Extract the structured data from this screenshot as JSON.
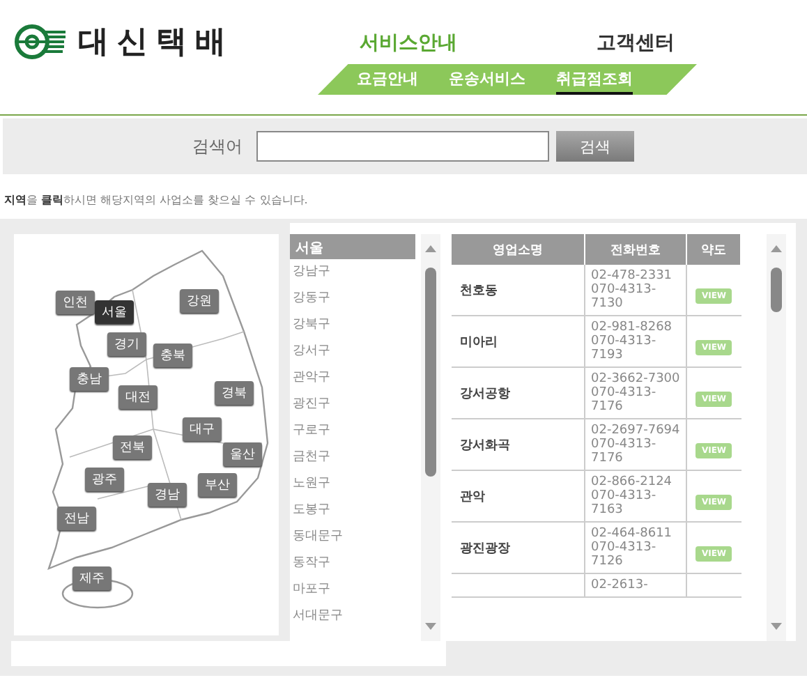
{
  "logo": {
    "name": "대신택배"
  },
  "nav": {
    "sections": [
      {
        "label": "서비스안내",
        "selected": true
      },
      {
        "label": "고객센터",
        "selected": false
      }
    ],
    "subtabs": [
      {
        "label": "요금안내",
        "selected": false
      },
      {
        "label": "운송서비스",
        "selected": false
      },
      {
        "label": "취급점조회",
        "selected": true
      }
    ]
  },
  "search": {
    "label": "검색어",
    "button": "검색"
  },
  "instruction": "**지역**을 **클릭**하시면 해당지역의 사업소를 찾으실 수 있습니다.",
  "map": {
    "regions": [
      {
        "label": "인천",
        "selected": false
      },
      {
        "label": "서울",
        "selected": true
      },
      {
        "label": "강원",
        "selected": false
      },
      {
        "label": "경기",
        "selected": false
      },
      {
        "label": "충북",
        "selected": false
      },
      {
        "label": "충남",
        "selected": false
      },
      {
        "label": "대전",
        "selected": false
      },
      {
        "label": "경북",
        "selected": false
      },
      {
        "label": "대구",
        "selected": false
      },
      {
        "label": "전북",
        "selected": false
      },
      {
        "label": "울산",
        "selected": false
      },
      {
        "label": "광주",
        "selected": false
      },
      {
        "label": "부산",
        "selected": false
      },
      {
        "label": "경남",
        "selected": false
      },
      {
        "label": "전남",
        "selected": false
      },
      {
        "label": "제주",
        "selected": false
      }
    ]
  },
  "districts": {
    "title": "서울",
    "items": [
      "강남구",
      "강동구",
      "강북구",
      "강서구",
      "관악구",
      "광진구",
      "구로구",
      "금천구",
      "노원구",
      "도봉구",
      "동대문구",
      "동작구",
      "마포구",
      "서대문구"
    ]
  },
  "table": {
    "columns": [
      "영업소명",
      "전화번호",
      "약도"
    ],
    "rows": [
      {
        "name": "천호동",
        "phones": [
          "02-478-2331",
          "070-4313-7130"
        ],
        "map": "VIEW"
      },
      {
        "name": "미아리",
        "phones": [
          "02-981-8268",
          "070-4313-7193"
        ],
        "map": "VIEW"
      },
      {
        "name": "강서공항",
        "phones": [
          "02-3662-7300",
          "070-4313-7176"
        ],
        "map": "VIEW"
      },
      {
        "name": "강서화곡",
        "phones": [
          "02-2697-7694",
          "070-4313-7176"
        ],
        "map": "VIEW"
      },
      {
        "name": "관악",
        "phones": [
          "02-866-2124",
          "070-4313-7163"
        ],
        "map": "VIEW"
      },
      {
        "name": "광진광장",
        "phones": [
          "02-464-8611",
          "070-4313-7126"
        ],
        "map": "VIEW"
      },
      {
        "name": "",
        "phones": [
          "02-2613-"
        ],
        "map": ""
      }
    ]
  }
}
